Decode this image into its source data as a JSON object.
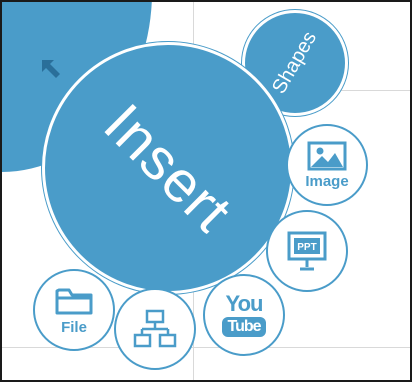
{
  "menu": {
    "insert_label": "Insert",
    "shapes_label": "Shapes",
    "back_icon": "arrow-up-left-icon",
    "tools": [
      {
        "id": "image",
        "label": "Image",
        "icon": "image-icon"
      },
      {
        "id": "ppt",
        "label": "PPT",
        "icon": "presentation-icon"
      },
      {
        "id": "youtube",
        "label_top": "You",
        "label_box": "Tube",
        "icon": "youtube-icon"
      },
      {
        "id": "orgchart",
        "icon": "org-chart-icon"
      },
      {
        "id": "file",
        "label": "File",
        "icon": "folder-icon"
      }
    ]
  },
  "colors": {
    "accent": "#4a9cc9",
    "background": "#ffffff",
    "grid": "#d9d9d9"
  }
}
